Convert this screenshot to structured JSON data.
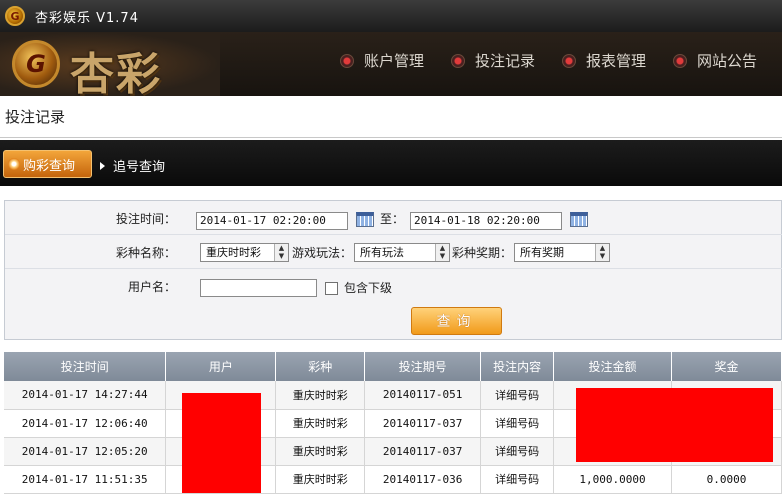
{
  "window": {
    "title": "杏彩娱乐 V1.74",
    "logo_text": "G"
  },
  "brand": {
    "emblem": "G",
    "name": "杏彩"
  },
  "nav": [
    {
      "label": "账户管理"
    },
    {
      "label": "投注记录"
    },
    {
      "label": "报表管理"
    },
    {
      "label": "网站公告"
    }
  ],
  "page": {
    "title": "投注记录"
  },
  "tabs": {
    "active": "购彩查询",
    "other": "追号查询"
  },
  "filter": {
    "time_label": "投注时间：",
    "start_time": "2014-01-17 02:20:00",
    "to_label": "至：",
    "end_time": "2014-01-18 02:20:00",
    "lottery_label": "彩种名称：",
    "lottery_value": "重庆时时彩",
    "play_label": "游戏玩法：",
    "play_value": "所有玩法",
    "prize_label": "彩种奖期：",
    "prize_value": "所有奖期",
    "user_label": "用户名：",
    "username": "",
    "include_sub_label": "包含下级",
    "query_button": "查询"
  },
  "table": {
    "headers": [
      "投注时间",
      "用户",
      "彩种",
      "投注期号",
      "投注内容",
      "投注金额",
      "奖金"
    ],
    "rows": [
      {
        "time": "2014-01-17 14:27:44",
        "user": "",
        "lottery": "重庆时时彩",
        "issue": "20140117-051",
        "content": "详细号码",
        "amount": "",
        "prize": ""
      },
      {
        "time": "2014-01-17 12:06:40",
        "user": "",
        "lottery": "重庆时时彩",
        "issue": "20140117-037",
        "content": "详细号码",
        "amount": "",
        "prize": ""
      },
      {
        "time": "2014-01-17 12:05:20",
        "user": "",
        "lottery": "重庆时时彩",
        "issue": "20140117-037",
        "content": "详细号码",
        "amount": "",
        "prize": ""
      },
      {
        "time": "2014-01-17 11:51:35",
        "user": "",
        "lottery": "重庆时时彩",
        "issue": "20140117-036",
        "content": "详细号码",
        "amount": "1,000.0000",
        "prize": "0.0000"
      }
    ]
  },
  "colors": {
    "redaction": "#ff0000",
    "accent_orange": "#f19a1a",
    "detail_link": "#2e7d1a",
    "header_bg": "#17130f"
  }
}
